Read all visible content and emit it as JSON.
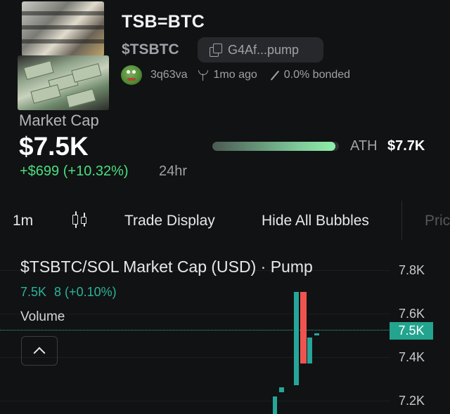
{
  "token": {
    "name": "TSB=BTC",
    "ticker": "$TSBTC",
    "address_short": "G4Af...pump",
    "creator": "3q63va",
    "age": "1mo ago",
    "bonded": "0.0% bonded"
  },
  "market_cap": {
    "label": "Market Cap",
    "value": "$7.5K",
    "change": "+$699 (+10.32%)",
    "period": "24hr",
    "ath_label": "ATH",
    "ath_value": "$7.7K",
    "ath_progress_percent": 97
  },
  "toolbar": {
    "interval": "1m",
    "candle_icon": "candlestick-icon",
    "trade_display": "Trade Display",
    "hide_bubbles": "Hide All Bubbles",
    "next_item_partial": "Pric"
  },
  "chart": {
    "title": "$TSBTC/SOL Market Cap (USD) · Pump",
    "ohlc_value": "7.5K",
    "ohlc_change": "8 (+0.10%)",
    "volume_label": "Volume",
    "price_ticks": [
      "7.8K",
      "7.6K",
      "7.4K",
      "7.2K"
    ],
    "current_price": "7.5K",
    "up_color": "#26a69a",
    "down_color": "#ef5350"
  },
  "chart_data": {
    "type": "candlestick",
    "title": "$TSBTC/SOL Market Cap (USD) · Pump",
    "y_ticks": [
      7.8,
      7.6,
      7.4,
      7.2
    ],
    "y_unit": "K",
    "current": 7.5,
    "candles": [
      {
        "open": 7.14,
        "close": 7.22,
        "high": 7.22,
        "low": 7.14,
        "dir": "up"
      },
      {
        "open": 7.24,
        "close": 7.26,
        "high": 7.26,
        "low": 7.24,
        "dir": "up"
      },
      {
        "open": 7.27,
        "close": 7.7,
        "high": 7.7,
        "low": 7.27,
        "dir": "up"
      },
      {
        "open": 7.7,
        "close": 7.37,
        "high": 7.7,
        "low": 7.37,
        "dir": "down"
      },
      {
        "open": 7.37,
        "close": 7.49,
        "high": 7.5,
        "low": 7.37,
        "dir": "up"
      },
      {
        "open": 7.5,
        "close": 7.51,
        "high": 7.51,
        "low": 7.5,
        "dir": "up"
      }
    ]
  }
}
